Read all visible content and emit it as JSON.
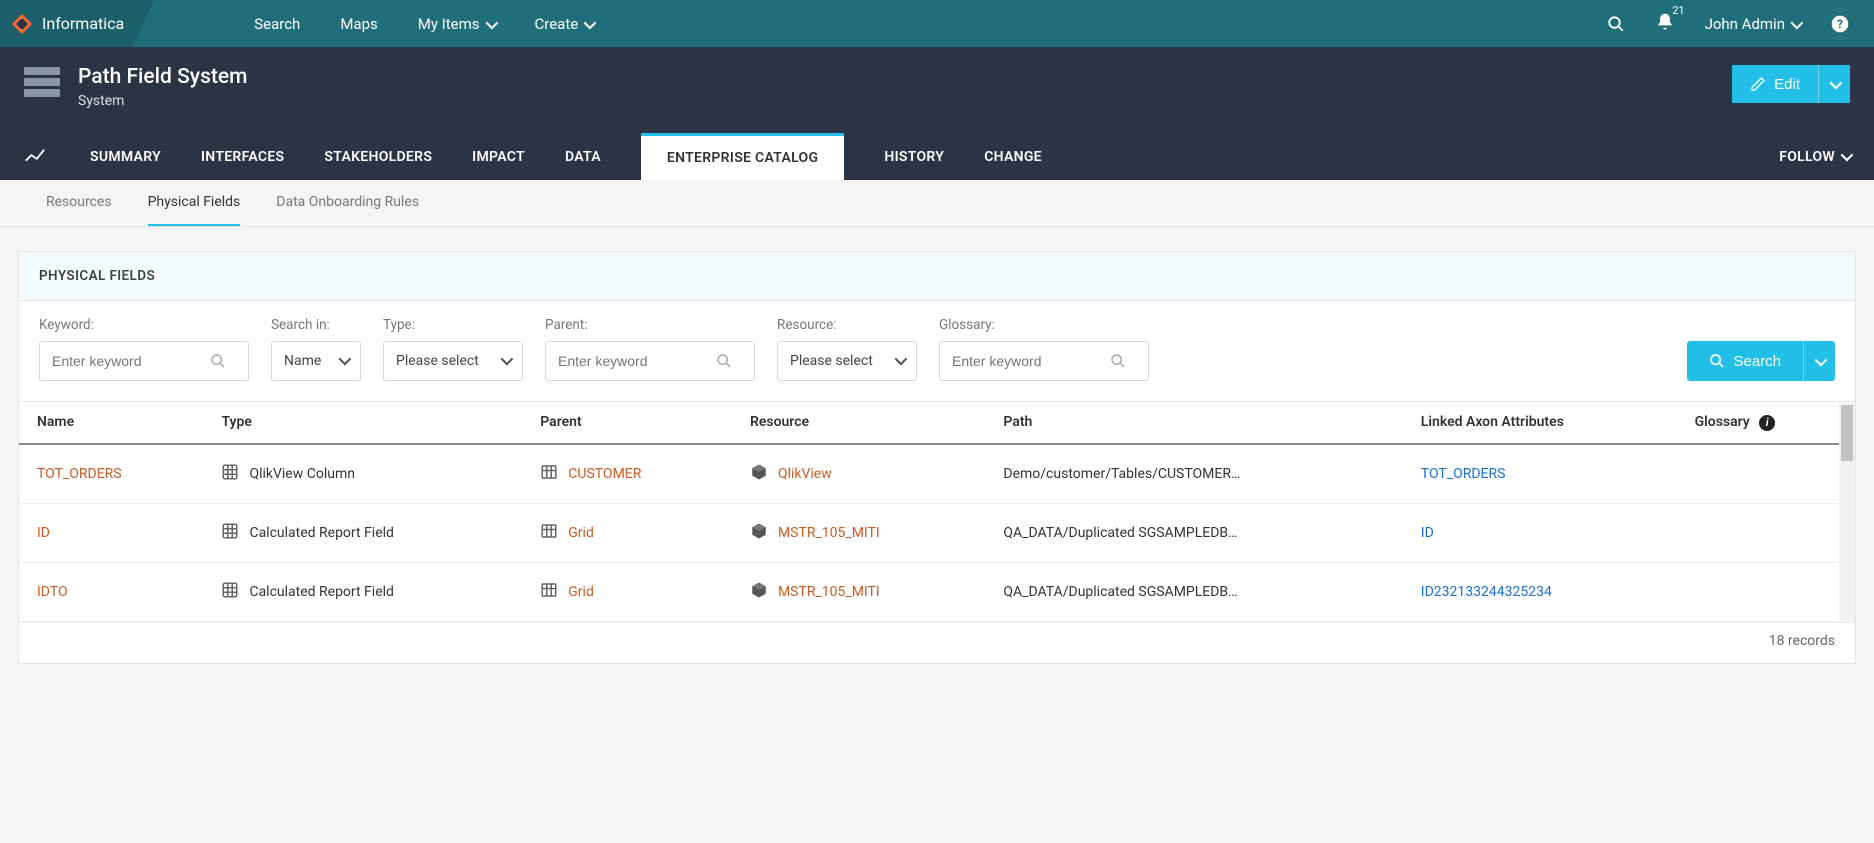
{
  "brand": "Informatica",
  "topnav": {
    "items": [
      "Search",
      "Maps",
      "My Items",
      "Create"
    ],
    "items_dropdown": [
      false,
      false,
      true,
      true
    ],
    "notifications": "21",
    "user": "John Admin"
  },
  "page": {
    "title": "Path Field System",
    "subtitle": "System",
    "edit_label": "Edit"
  },
  "tabs": {
    "items": [
      "SUMMARY",
      "INTERFACES",
      "STAKEHOLDERS",
      "IMPACT",
      "DATA",
      "ENTERPRISE CATALOG",
      "HISTORY",
      "CHANGE"
    ],
    "active_index": 5,
    "follow_label": "FOLLOW"
  },
  "subtabs": {
    "items": [
      "Resources",
      "Physical Fields",
      "Data Onboarding Rules"
    ],
    "active_index": 1
  },
  "card": {
    "title": "PHYSICAL FIELDS",
    "footer": "18 records"
  },
  "filters": {
    "keyword": {
      "label": "Keyword:",
      "placeholder": "Enter keyword"
    },
    "search_in": {
      "label": "Search in:",
      "value": "Name"
    },
    "type": {
      "label": "Type:",
      "value": "Please select"
    },
    "parent": {
      "label": "Parent:",
      "placeholder": "Enter keyword"
    },
    "resource": {
      "label": "Resource:",
      "value": "Please select"
    },
    "glossary": {
      "label": "Glossary:",
      "placeholder": "Enter keyword"
    },
    "search_button": "Search"
  },
  "table": {
    "columns": [
      "Name",
      "Type",
      "Parent",
      "Resource",
      "Path",
      "Linked Axon Attributes",
      "Glossary"
    ],
    "rows": [
      {
        "name": "TOT_ORDERS",
        "type": "QlikView Column",
        "parent": "CUSTOMER",
        "resource": "QlikView",
        "path": "Demo/customer/Tables/CUSTOMER…",
        "linked": "TOT_ORDERS",
        "glossary": ""
      },
      {
        "name": "ID",
        "type": "Calculated Report Field",
        "parent": "Grid",
        "resource": "MSTR_105_MITI",
        "path": "QA_DATA/Duplicated SGSAMPLEDB…",
        "linked": "ID",
        "glossary": ""
      },
      {
        "name": "IDTO",
        "type": "Calculated Report Field",
        "parent": "Grid",
        "resource": "MSTR_105_MITI",
        "path": "QA_DATA/Duplicated SGSAMPLEDB…",
        "linked": "ID232133244325234",
        "glossary": ""
      }
    ]
  }
}
